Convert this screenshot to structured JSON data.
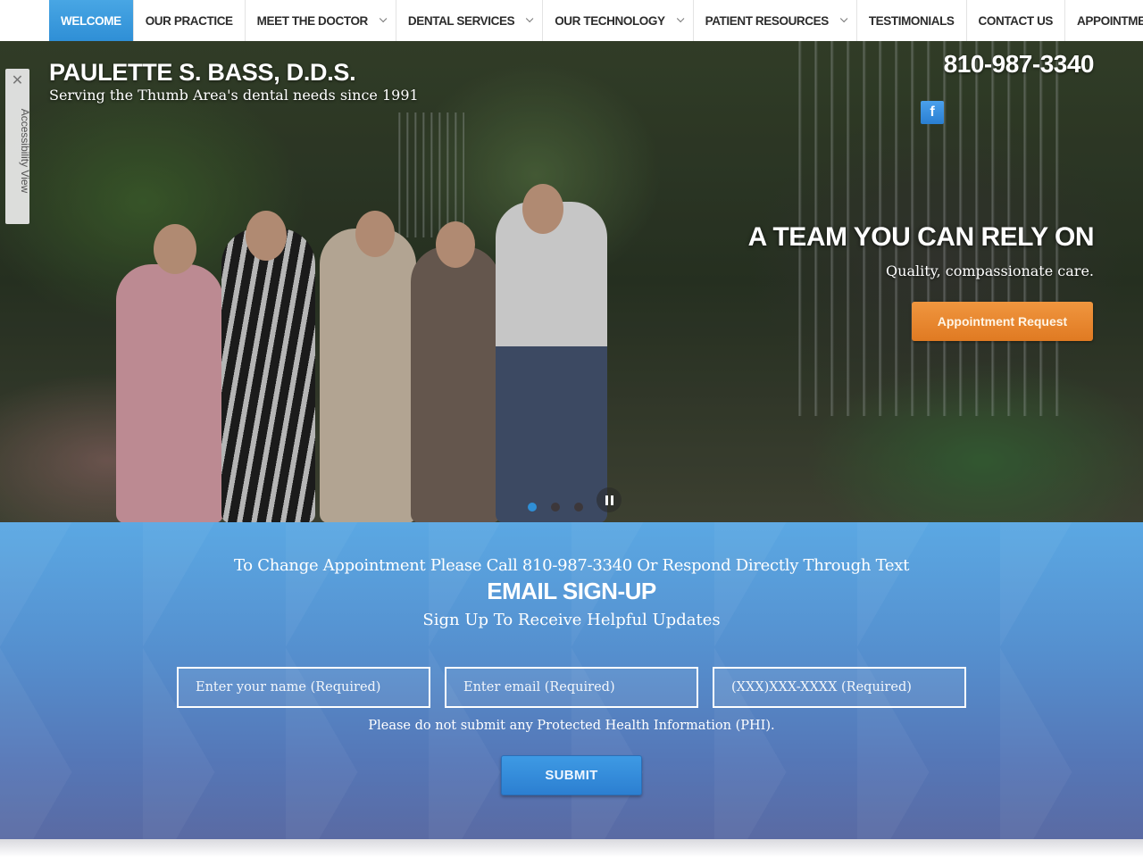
{
  "nav": {
    "items": [
      {
        "label": "Welcome",
        "active": true,
        "has_dropdown": false
      },
      {
        "label": "Our Practice",
        "active": false,
        "has_dropdown": false
      },
      {
        "label": "Meet the Doctor",
        "active": false,
        "has_dropdown": true
      },
      {
        "label": "Dental Services",
        "active": false,
        "has_dropdown": true
      },
      {
        "label": "Our Technology",
        "active": false,
        "has_dropdown": true
      },
      {
        "label": "Patient Resources",
        "active": false,
        "has_dropdown": true
      },
      {
        "label": "Testimonials",
        "active": false,
        "has_dropdown": false
      },
      {
        "label": "Contact Us",
        "active": false,
        "has_dropdown": false
      },
      {
        "label": "Appointment Request",
        "active": false,
        "has_dropdown": false
      }
    ],
    "active_color": "#3a9be0"
  },
  "header": {
    "brand_name": "PAULETTE S. BASS, D.D.S.",
    "tagline": "Serving the Thumb Area's dental needs since 1991",
    "phone": "810-987-3340",
    "social_icon": "facebook-icon",
    "social_glyph": "f"
  },
  "accessibility": {
    "close_glyph": "✕",
    "label": "Accessibility View"
  },
  "hero": {
    "title": "A TEAM YOU CAN RELY ON",
    "subtitle": "Quality, compassionate care.",
    "cta_label": "Appointment Request",
    "cta_color": "#e8852e",
    "slides_total": 3,
    "active_slide": 1,
    "pause_icon": "pause-icon"
  },
  "signup": {
    "change_appointment_text": "To Change Appointment Please Call 810-987-3340 Or Respond Directly Through Text",
    "title": "EMAIL SIGN-UP",
    "subtitle": "Sign Up To Receive Helpful Updates",
    "fields": {
      "name_placeholder": "Enter your name (Required)",
      "name_value": "",
      "email_placeholder": "Enter email (Required)",
      "email_value": "",
      "phone_placeholder": "(XXX)XXX-XXXX (Required)",
      "phone_value": ""
    },
    "phi_note": "Please do not submit any Protected Health Information (PHI).",
    "submit_label": "SUBMIT",
    "submit_color": "#3590dc"
  }
}
